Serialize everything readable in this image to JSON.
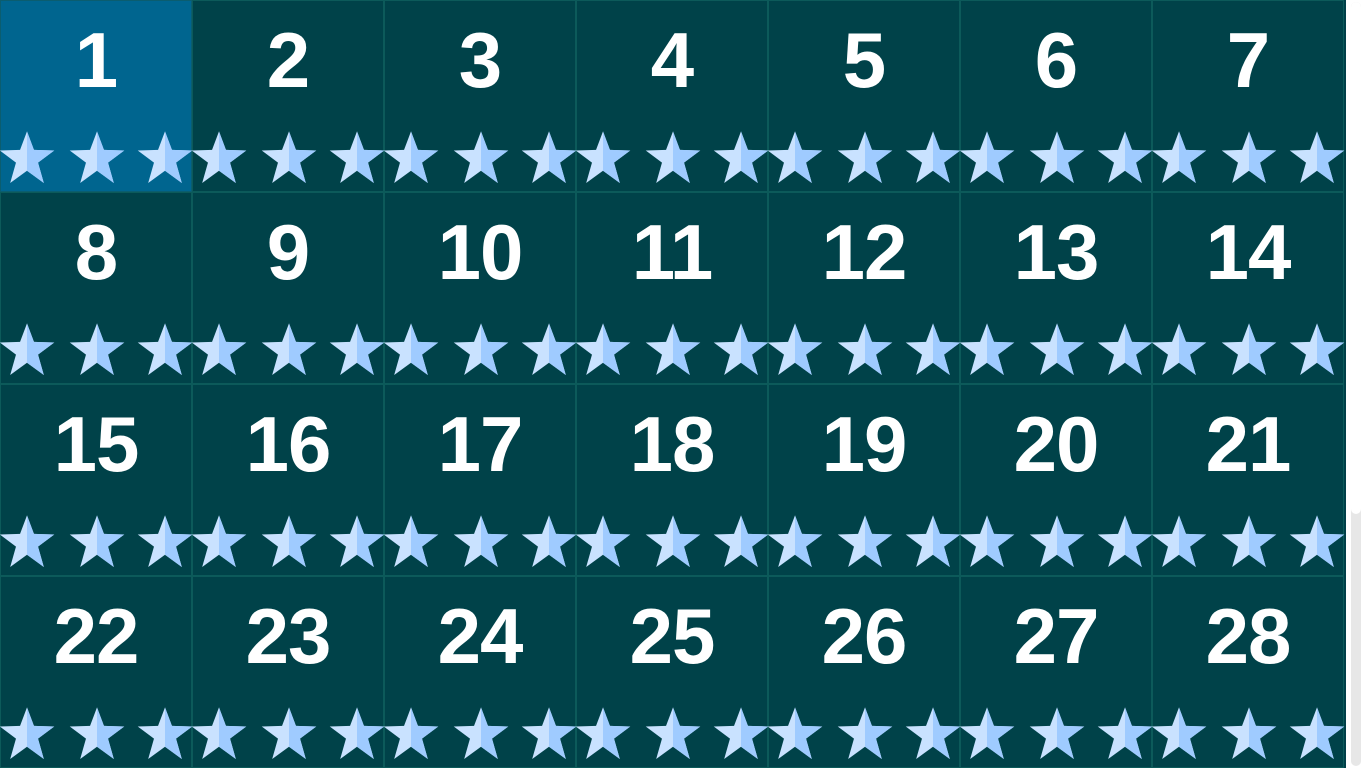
{
  "app": {
    "theme": {
      "background": "#003f48",
      "tile": "#004249",
      "tile_selected": "#00658f",
      "number_color": "#ffffff",
      "star_light": "#c9e2ff",
      "star_dark": "#9fcbff"
    }
  },
  "levels": [
    {
      "number": "1",
      "stars": 3,
      "selected": true
    },
    {
      "number": "2",
      "stars": 3
    },
    {
      "number": "3",
      "stars": 3
    },
    {
      "number": "4",
      "stars": 3
    },
    {
      "number": "5",
      "stars": 3
    },
    {
      "number": "6",
      "stars": 3
    },
    {
      "number": "7",
      "stars": 3
    },
    {
      "number": "8",
      "stars": 3
    },
    {
      "number": "9",
      "stars": 3
    },
    {
      "number": "10",
      "stars": 3
    },
    {
      "number": "11",
      "stars": 3
    },
    {
      "number": "12",
      "stars": 3
    },
    {
      "number": "13",
      "stars": 3
    },
    {
      "number": "14",
      "stars": 3
    },
    {
      "number": "15",
      "stars": 3
    },
    {
      "number": "16",
      "stars": 3
    },
    {
      "number": "17",
      "stars": 3
    },
    {
      "number": "18",
      "stars": 3
    },
    {
      "number": "19",
      "stars": 3
    },
    {
      "number": "20",
      "stars": 3
    },
    {
      "number": "21",
      "stars": 3
    },
    {
      "number": "22",
      "stars": 3
    },
    {
      "number": "23",
      "stars": 3
    },
    {
      "number": "24",
      "stars": 3
    },
    {
      "number": "25",
      "stars": 3
    },
    {
      "number": "26",
      "stars": 3
    },
    {
      "number": "27",
      "stars": 3
    },
    {
      "number": "28",
      "stars": 3
    }
  ],
  "scroll": {
    "position_fraction": 0.0,
    "visible_fraction": 0.67
  }
}
